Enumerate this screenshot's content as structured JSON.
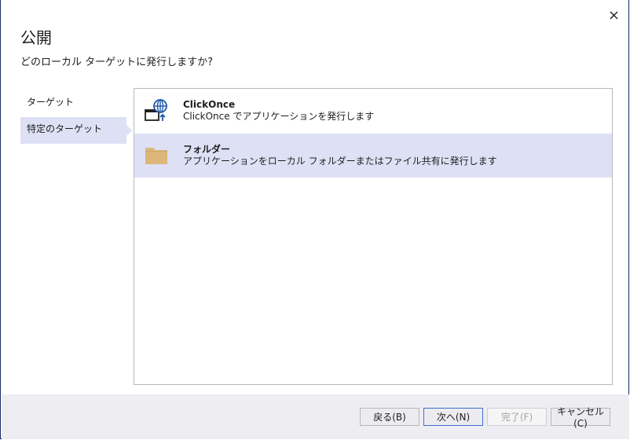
{
  "dialog": {
    "title": "公開",
    "subtitle": "どのローカル ターゲットに発行しますか?"
  },
  "sidebar": {
    "items": [
      {
        "label": "ターゲット"
      },
      {
        "label": "特定のターゲット"
      }
    ]
  },
  "list": {
    "items": [
      {
        "title": "ClickOnce",
        "description": "ClickOnce でアプリケーションを発行します",
        "icon": "clickonce-globe-icon"
      },
      {
        "title": "フォルダー",
        "description": "アプリケーションをローカル フォルダーまたはファイル共有に発行します",
        "icon": "folder-icon"
      }
    ]
  },
  "footer": {
    "back_label": "戻る(B)",
    "next_label": "次へ(N)",
    "finish_label": "完了(F)",
    "cancel_label": "キャンセル(C)"
  },
  "colors": {
    "selection": "#dee1f5",
    "accent_blue": "#1e5aa8",
    "folder": "#dcb67a",
    "footer_bg": "#eeeef2"
  }
}
